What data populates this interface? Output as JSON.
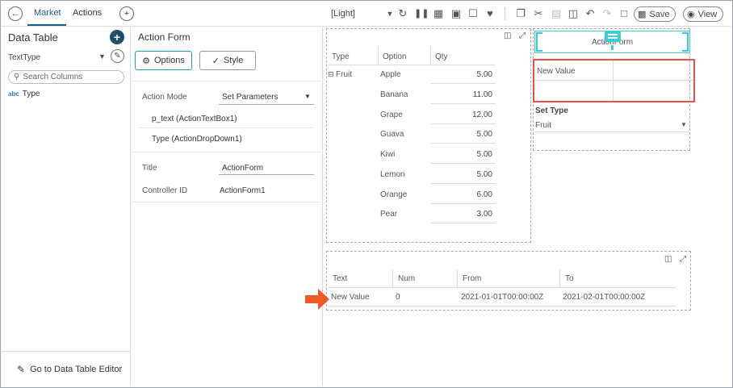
{
  "topbar": {
    "tabs": [
      "Market",
      "Actions"
    ],
    "theme": "[Light]",
    "save_label": "Save",
    "view_label": "View"
  },
  "left_panel": {
    "title": "Data Table",
    "source": "TextType",
    "search_placeholder": "Search Columns",
    "columns": [
      {
        "type": "abc",
        "name": "Type"
      }
    ],
    "goto_label": "Go to Data Table Editor"
  },
  "mid_panel": {
    "title": "Action Form",
    "options_label": "Options",
    "style_label": "Style",
    "action_mode_label": "Action Mode",
    "action_mode_value": "Set Parameters",
    "params": [
      "p_text (ActionTextBox1)",
      "Type (ActionDropDown1)"
    ],
    "title_label": "Title",
    "title_value": "ActionForm",
    "controller_label": "Controller ID",
    "controller_value": "ActionForm1"
  },
  "pivot_table": {
    "headers": [
      "Type",
      "Option",
      "Qty"
    ],
    "group": "Fruit",
    "rows": [
      {
        "option": "Apple",
        "qty": "5.00"
      },
      {
        "option": "Banana",
        "qty": "11.00"
      },
      {
        "option": "Grape",
        "qty": "12.00"
      },
      {
        "option": "Guava",
        "qty": "5.00"
      },
      {
        "option": "Kiwi",
        "qty": "5.00"
      },
      {
        "option": "Lemon",
        "qty": "5.00"
      },
      {
        "option": "Orange",
        "qty": "6.00"
      },
      {
        "option": "Pear",
        "qty": "3.00"
      }
    ]
  },
  "action_form": {
    "header": "ActionForm",
    "text_value": "New Value",
    "set_type_label": "Set Type",
    "set_type_value": "Fruit"
  },
  "result_table": {
    "headers": [
      "Text",
      "Num",
      "From",
      "To"
    ],
    "row": [
      "New Value",
      "0",
      "2021-01-01T00:00:00Z",
      "2021-02-01T00:00:00Z"
    ]
  },
  "colors": {
    "accent": "#1a5d8a",
    "highlight": "#e4524a",
    "selection": "#3ecad6",
    "arrow": "#f05a24"
  }
}
